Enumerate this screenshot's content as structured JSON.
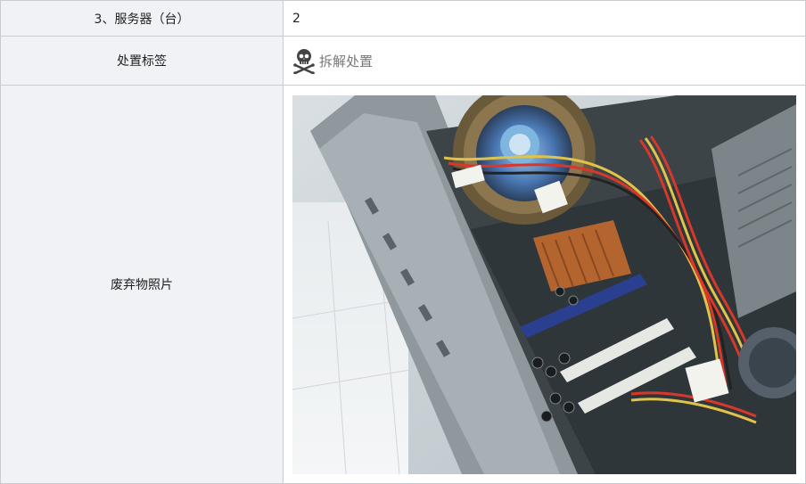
{
  "table": {
    "rows": [
      {
        "label": "3、服务器（台）",
        "value": "2"
      },
      {
        "label": "处置标签",
        "value": "拆解处置",
        "icon": "skull-crossbones-icon"
      },
      {
        "label": "废弃物照片",
        "image": "computer-case-interior-photo"
      }
    ]
  },
  "colors": {
    "label_bg": "#f0f2f5",
    "border": "#c8ccd1",
    "tag_text": "#777777"
  }
}
